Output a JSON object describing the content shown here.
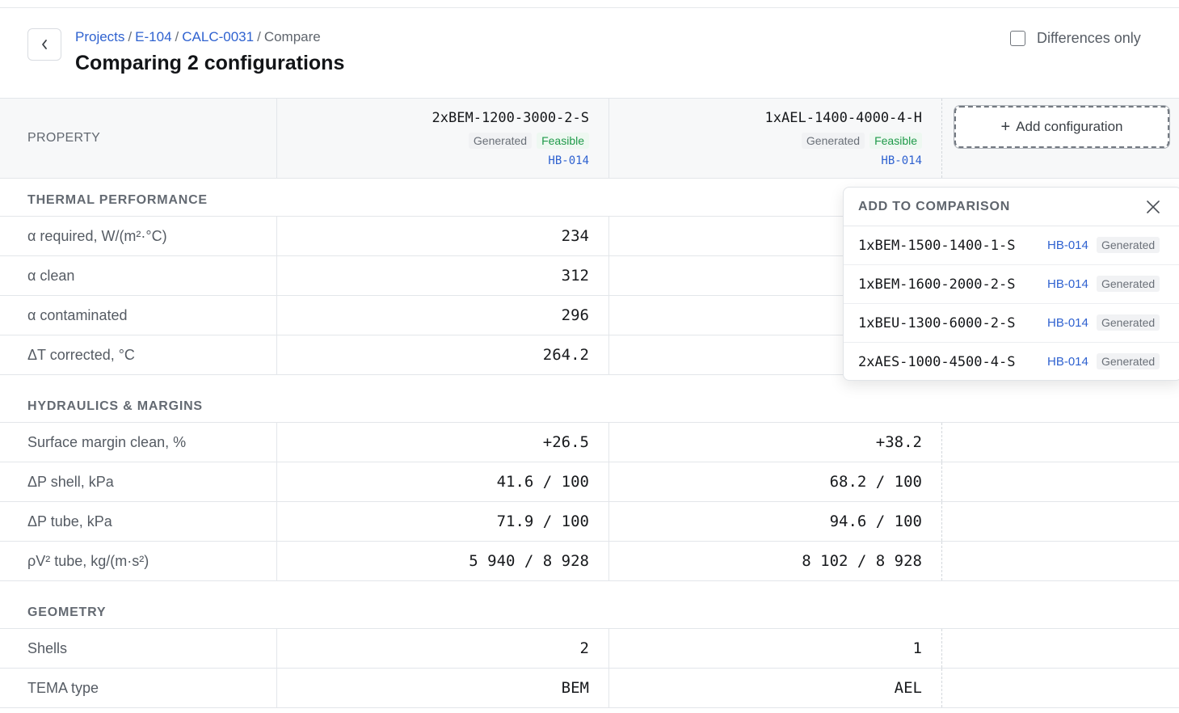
{
  "breadcrumb": {
    "projects": "Projects",
    "equipment": "E-104",
    "calc": "CALC-0031",
    "current": "Compare",
    "separator": "/"
  },
  "page_title": "Comparing 2 configurations",
  "back_button_icon": "chevron-left-icon",
  "differences_only": {
    "label": "Differences only",
    "checked": false
  },
  "table": {
    "property_header": "PROPERTY",
    "configs": [
      {
        "name": "2xBEM-1200-3000-2-S",
        "source_badge": "Generated",
        "status_badge": "Feasible",
        "ref": "HB-014"
      },
      {
        "name": "1xAEL-1400-4000-4-H",
        "source_badge": "Generated",
        "status_badge": "Feasible",
        "ref": "HB-014"
      }
    ],
    "add_configuration": {
      "plus": "+",
      "label": "Add configuration"
    },
    "sections": [
      {
        "title": "THERMAL PERFORMANCE",
        "rows": [
          {
            "label": "α required, W/(m²·°C)",
            "values": [
              "234",
              ""
            ]
          },
          {
            "label": "α clean",
            "values": [
              "312",
              ""
            ]
          },
          {
            "label": "α contaminated",
            "values": [
              "296",
              ""
            ]
          },
          {
            "label": "ΔT corrected, °C",
            "values": [
              "264.2",
              ""
            ]
          }
        ]
      },
      {
        "title": "HYDRAULICS & MARGINS",
        "rows": [
          {
            "label": "Surface margin clean, %",
            "values": [
              "+26.5",
              "+38.2"
            ]
          },
          {
            "label": "ΔP shell, kPa",
            "values": [
              "41.6 / 100",
              "68.2 / 100"
            ]
          },
          {
            "label": "ΔP tube, kPa",
            "values": [
              "71.9 / 100",
              "94.6 / 100"
            ]
          },
          {
            "label": "ρV² tube, kg/(m·s²)",
            "values": [
              "5 940 / 8 928",
              "8 102 / 8 928"
            ]
          }
        ]
      },
      {
        "title": "GEOMETRY",
        "rows": [
          {
            "label": "Shells",
            "values": [
              "2",
              "1"
            ]
          },
          {
            "label": "TEMA type",
            "values": [
              "BEM",
              "AEL"
            ]
          }
        ]
      }
    ]
  },
  "popover": {
    "title": "ADD TO COMPARISON",
    "close_icon": "close-icon",
    "items": [
      {
        "name": "1xBEM-1500-1400-1-S",
        "ref": "HB-014",
        "badge": "Generated"
      },
      {
        "name": "1xBEM-1600-2000-2-S",
        "ref": "HB-014",
        "badge": "Generated"
      },
      {
        "name": "1xBEU-1300-6000-2-S",
        "ref": "HB-014",
        "badge": "Generated"
      },
      {
        "name": "2xAES-1000-4500-4-S",
        "ref": "HB-014",
        "badge": "Generated"
      }
    ]
  },
  "colors": {
    "link": "#2f62d0",
    "feasible": "#1f9a4a",
    "header_bg": "#f7f8f9"
  }
}
